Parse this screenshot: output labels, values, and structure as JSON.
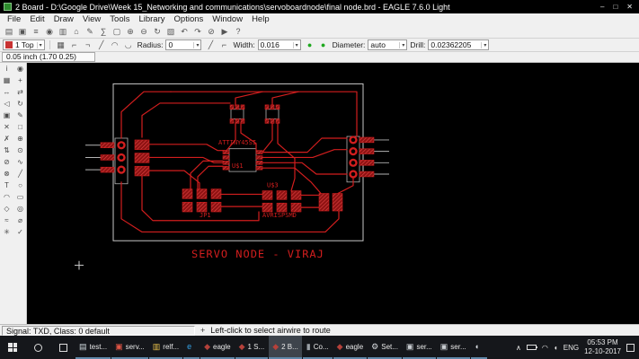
{
  "colors": {
    "trace": "#d21e1e",
    "pad-dark": "#8e1212",
    "pad-light": "#e34545",
    "outline": "#c9c9c9",
    "canvas-bg": "#000000",
    "taskbar-bg": "#15171b",
    "active-task": "#3e444c",
    "chrome": "#f0f0f0"
  },
  "titlebar": {
    "title": "2 Board - D:\\Google Drive\\Week 15_Networking and communications\\servoboardnode\\final node.brd - EAGLE 7.6.0 Light",
    "minimize": "–",
    "maximize": "□",
    "close": "✕"
  },
  "menu": {
    "items": [
      "File",
      "Edit",
      "Draw",
      "View",
      "Tools",
      "Library",
      "Options",
      "Window",
      "Help"
    ]
  },
  "toolbar1": {
    "icons": [
      {
        "name": "open-icon",
        "glyph": "▤"
      },
      {
        "name": "save-icon",
        "glyph": "▣"
      },
      {
        "name": "print-icon",
        "glyph": "≡"
      },
      {
        "name": "cam-icon",
        "glyph": "◉"
      },
      {
        "name": "board-schematic-icon",
        "glyph": "▥"
      },
      {
        "name": "library-icon",
        "glyph": "⌂"
      },
      {
        "name": "run-script-icon",
        "glyph": "✎"
      },
      {
        "name": "ulp-icon",
        "glyph": "∑"
      },
      {
        "name": "zoom-fit-icon",
        "glyph": "▢"
      },
      {
        "name": "zoom-in-icon",
        "glyph": "⊕"
      },
      {
        "name": "zoom-out-icon",
        "glyph": "⊖"
      },
      {
        "name": "redraw-icon",
        "glyph": "↻"
      },
      {
        "name": "zoom-select-icon",
        "glyph": "▧"
      },
      {
        "name": "undo-icon",
        "glyph": "↶"
      },
      {
        "name": "redo-icon",
        "glyph": "↷"
      },
      {
        "name": "stop-icon",
        "glyph": "⊘"
      },
      {
        "name": "go-icon",
        "glyph": "▶"
      },
      {
        "name": "help-icon",
        "glyph": "?"
      }
    ]
  },
  "toolbar2": {
    "layer_value": "1 Top",
    "bend_icons": [
      {
        "name": "grid-icon",
        "glyph": "▦"
      },
      {
        "name": "bend-style-1-icon",
        "glyph": "⌐"
      },
      {
        "name": "bend-style-2-icon",
        "glyph": "¬"
      },
      {
        "name": "bend-style-3-icon",
        "glyph": "╱"
      },
      {
        "name": "bend-style-4-icon",
        "glyph": "◠"
      },
      {
        "name": "bend-style-5-icon",
        "glyph": "◡"
      }
    ],
    "radius_label": "Radius:",
    "radius_value": "0",
    "wire_icons": [
      {
        "name": "wire-style-1-icon",
        "glyph": "╱"
      },
      {
        "name": "wire-style-2-icon",
        "glyph": "⌐"
      }
    ],
    "width_label": "Width:",
    "width_value": "0.016",
    "miter_icons": [
      {
        "name": "miter-round-icon",
        "glyph": "●",
        "color": "#1fa81f"
      },
      {
        "name": "miter-straight-icon",
        "glyph": "●",
        "color": "#1fa81f"
      }
    ],
    "diameter_label": "Diameter:",
    "diameter_value": "auto",
    "drill_label": "Drill:",
    "drill_value": "0.02362205"
  },
  "coords": {
    "value": "0.05 inch (1.70 0.25)"
  },
  "ui": {
    "dropdown_arrow": "▾"
  },
  "palette": {
    "tools": [
      {
        "name": "info-tool",
        "glyph": "i"
      },
      {
        "name": "show-tool",
        "glyph": "◉"
      },
      {
        "name": "display-tool",
        "glyph": "▦"
      },
      {
        "name": "mark-tool",
        "glyph": "+"
      },
      {
        "name": "move-tool",
        "glyph": "↔"
      },
      {
        "name": "copy-tool",
        "glyph": "⇄"
      },
      {
        "name": "mirror-tool",
        "glyph": "◁"
      },
      {
        "name": "rotate-tool",
        "glyph": "↻"
      },
      {
        "name": "group-tool",
        "glyph": "▣"
      },
      {
        "name": "change-tool",
        "glyph": "✎"
      },
      {
        "name": "cut-tool",
        "glyph": "✕"
      },
      {
        "name": "paste-tool",
        "glyph": "□"
      },
      {
        "name": "delete-tool",
        "glyph": "✗"
      },
      {
        "name": "add-tool",
        "glyph": "⊕"
      },
      {
        "name": "pinswap-tool",
        "glyph": "⇅"
      },
      {
        "name": "replace-tool",
        "glyph": "⊙"
      },
      {
        "name": "lock-tool",
        "glyph": "⊘"
      },
      {
        "name": "route-tool",
        "glyph": "∿"
      },
      {
        "name": "ripup-tool",
        "glyph": "⊗"
      },
      {
        "name": "wire-tool",
        "glyph": "╱"
      },
      {
        "name": "text-tool",
        "glyph": "T"
      },
      {
        "name": "circle-tool",
        "glyph": "○"
      },
      {
        "name": "arc-tool",
        "glyph": "◠"
      },
      {
        "name": "rect-tool",
        "glyph": "▭"
      },
      {
        "name": "polygon-tool",
        "glyph": "◇"
      },
      {
        "name": "via-tool",
        "glyph": "◎"
      },
      {
        "name": "signal-tool",
        "glyph": "≈"
      },
      {
        "name": "hole-tool",
        "glyph": "⌀"
      },
      {
        "name": "ratsnest-tool",
        "glyph": "✳"
      },
      {
        "name": "drc-tool",
        "glyph": "✓"
      }
    ]
  },
  "pcb": {
    "labels": [
      {
        "text": "ATTINY45SI"
      },
      {
        "text": "U$1"
      },
      {
        "text": "U$3"
      },
      {
        "text": "JP1"
      },
      {
        "text": "AVRISPSMD"
      },
      {
        "text": "SERVO NODE - VIRAJ"
      }
    ]
  },
  "statusbar": {
    "signal": "Signal: TXD, Class: 0 default",
    "hint_icon": "+",
    "hint": "Left-click to select airwire to route"
  },
  "taskbar": {
    "items": [
      {
        "name": "taskbar-app-test",
        "label": "test...",
        "icon": "▤",
        "color": "#cfd8dc"
      },
      {
        "name": "taskbar-app-serv",
        "label": "serv...",
        "icon": "▣",
        "color": "#e05545"
      },
      {
        "name": "taskbar-app-relf",
        "label": "relf...",
        "icon": "▥",
        "color": "#e8c04a"
      },
      {
        "name": "taskbar-app-edge",
        "label": "",
        "icon": "e",
        "color": "#35a3e8"
      },
      {
        "name": "taskbar-app-eagle-cp",
        "label": "eagle",
        "icon": "◆",
        "color": "#b5413a"
      },
      {
        "name": "taskbar-app-schematic",
        "label": "1 S...",
        "icon": "◆",
        "color": "#b5413a"
      },
      {
        "name": "taskbar-app-board",
        "label": "2 B...",
        "icon": "◆",
        "color": "#b5413a",
        "active": true
      },
      {
        "name": "taskbar-app-console",
        "label": "Co...",
        "icon": "▮",
        "color": "#9aa0a6"
      },
      {
        "name": "taskbar-app-eagle2",
        "label": "eagle",
        "icon": "◆",
        "color": "#b5413a"
      },
      {
        "name": "taskbar-app-settings",
        "label": "Set...",
        "icon": "⚙",
        "color": "#d8dce0"
      },
      {
        "name": "taskbar-app-ser1",
        "label": "ser...",
        "icon": "▣",
        "color": "#c8ccd0"
      },
      {
        "name": "taskbar-app-ser2",
        "label": "ser...",
        "icon": "▣",
        "color": "#c8ccd0"
      },
      {
        "name": "taskbar-app-sound",
        "label": "",
        "icon": "◖",
        "color": "#d8dce0"
      }
    ],
    "tray": {
      "expand_glyph": "∧",
      "wifi_glyph": "◠",
      "volume_glyph": "◖",
      "lang": "ENG",
      "time": "05:53 PM",
      "date": "12-10-2017"
    }
  }
}
